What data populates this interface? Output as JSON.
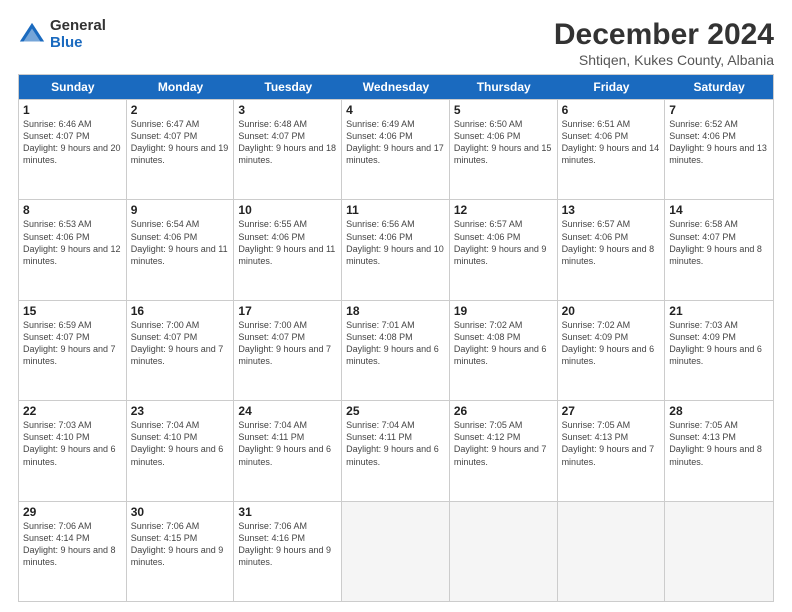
{
  "logo": {
    "general": "General",
    "blue": "Blue"
  },
  "title": "December 2024",
  "subtitle": "Shtiqen, Kukes County, Albania",
  "header_days": [
    "Sunday",
    "Monday",
    "Tuesday",
    "Wednesday",
    "Thursday",
    "Friday",
    "Saturday"
  ],
  "weeks": [
    [
      {
        "day": "1",
        "sunrise": "6:46 AM",
        "sunset": "4:07 PM",
        "daylight": "9 hours and 20 minutes."
      },
      {
        "day": "2",
        "sunrise": "6:47 AM",
        "sunset": "4:07 PM",
        "daylight": "9 hours and 19 minutes."
      },
      {
        "day": "3",
        "sunrise": "6:48 AM",
        "sunset": "4:07 PM",
        "daylight": "9 hours and 18 minutes."
      },
      {
        "day": "4",
        "sunrise": "6:49 AM",
        "sunset": "4:06 PM",
        "daylight": "9 hours and 17 minutes."
      },
      {
        "day": "5",
        "sunrise": "6:50 AM",
        "sunset": "4:06 PM",
        "daylight": "9 hours and 15 minutes."
      },
      {
        "day": "6",
        "sunrise": "6:51 AM",
        "sunset": "4:06 PM",
        "daylight": "9 hours and 14 minutes."
      },
      {
        "day": "7",
        "sunrise": "6:52 AM",
        "sunset": "4:06 PM",
        "daylight": "9 hours and 13 minutes."
      }
    ],
    [
      {
        "day": "8",
        "sunrise": "6:53 AM",
        "sunset": "4:06 PM",
        "daylight": "9 hours and 12 minutes."
      },
      {
        "day": "9",
        "sunrise": "6:54 AM",
        "sunset": "4:06 PM",
        "daylight": "9 hours and 11 minutes."
      },
      {
        "day": "10",
        "sunrise": "6:55 AM",
        "sunset": "4:06 PM",
        "daylight": "9 hours and 11 minutes."
      },
      {
        "day": "11",
        "sunrise": "6:56 AM",
        "sunset": "4:06 PM",
        "daylight": "9 hours and 10 minutes."
      },
      {
        "day": "12",
        "sunrise": "6:57 AM",
        "sunset": "4:06 PM",
        "daylight": "9 hours and 9 minutes."
      },
      {
        "day": "13",
        "sunrise": "6:57 AM",
        "sunset": "4:06 PM",
        "daylight": "9 hours and 8 minutes."
      },
      {
        "day": "14",
        "sunrise": "6:58 AM",
        "sunset": "4:07 PM",
        "daylight": "9 hours and 8 minutes."
      }
    ],
    [
      {
        "day": "15",
        "sunrise": "6:59 AM",
        "sunset": "4:07 PM",
        "daylight": "9 hours and 7 minutes."
      },
      {
        "day": "16",
        "sunrise": "7:00 AM",
        "sunset": "4:07 PM",
        "daylight": "9 hours and 7 minutes."
      },
      {
        "day": "17",
        "sunrise": "7:00 AM",
        "sunset": "4:07 PM",
        "daylight": "9 hours and 7 minutes."
      },
      {
        "day": "18",
        "sunrise": "7:01 AM",
        "sunset": "4:08 PM",
        "daylight": "9 hours and 6 minutes."
      },
      {
        "day": "19",
        "sunrise": "7:02 AM",
        "sunset": "4:08 PM",
        "daylight": "9 hours and 6 minutes."
      },
      {
        "day": "20",
        "sunrise": "7:02 AM",
        "sunset": "4:09 PM",
        "daylight": "9 hours and 6 minutes."
      },
      {
        "day": "21",
        "sunrise": "7:03 AM",
        "sunset": "4:09 PM",
        "daylight": "9 hours and 6 minutes."
      }
    ],
    [
      {
        "day": "22",
        "sunrise": "7:03 AM",
        "sunset": "4:10 PM",
        "daylight": "9 hours and 6 minutes."
      },
      {
        "day": "23",
        "sunrise": "7:04 AM",
        "sunset": "4:10 PM",
        "daylight": "9 hours and 6 minutes."
      },
      {
        "day": "24",
        "sunrise": "7:04 AM",
        "sunset": "4:11 PM",
        "daylight": "9 hours and 6 minutes."
      },
      {
        "day": "25",
        "sunrise": "7:04 AM",
        "sunset": "4:11 PM",
        "daylight": "9 hours and 6 minutes."
      },
      {
        "day": "26",
        "sunrise": "7:05 AM",
        "sunset": "4:12 PM",
        "daylight": "9 hours and 7 minutes."
      },
      {
        "day": "27",
        "sunrise": "7:05 AM",
        "sunset": "4:13 PM",
        "daylight": "9 hours and 7 minutes."
      },
      {
        "day": "28",
        "sunrise": "7:05 AM",
        "sunset": "4:13 PM",
        "daylight": "9 hours and 8 minutes."
      }
    ],
    [
      {
        "day": "29",
        "sunrise": "7:06 AM",
        "sunset": "4:14 PM",
        "daylight": "9 hours and 8 minutes."
      },
      {
        "day": "30",
        "sunrise": "7:06 AM",
        "sunset": "4:15 PM",
        "daylight": "9 hours and 9 minutes."
      },
      {
        "day": "31",
        "sunrise": "7:06 AM",
        "sunset": "4:16 PM",
        "daylight": "9 hours and 9 minutes."
      },
      null,
      null,
      null,
      null
    ]
  ]
}
